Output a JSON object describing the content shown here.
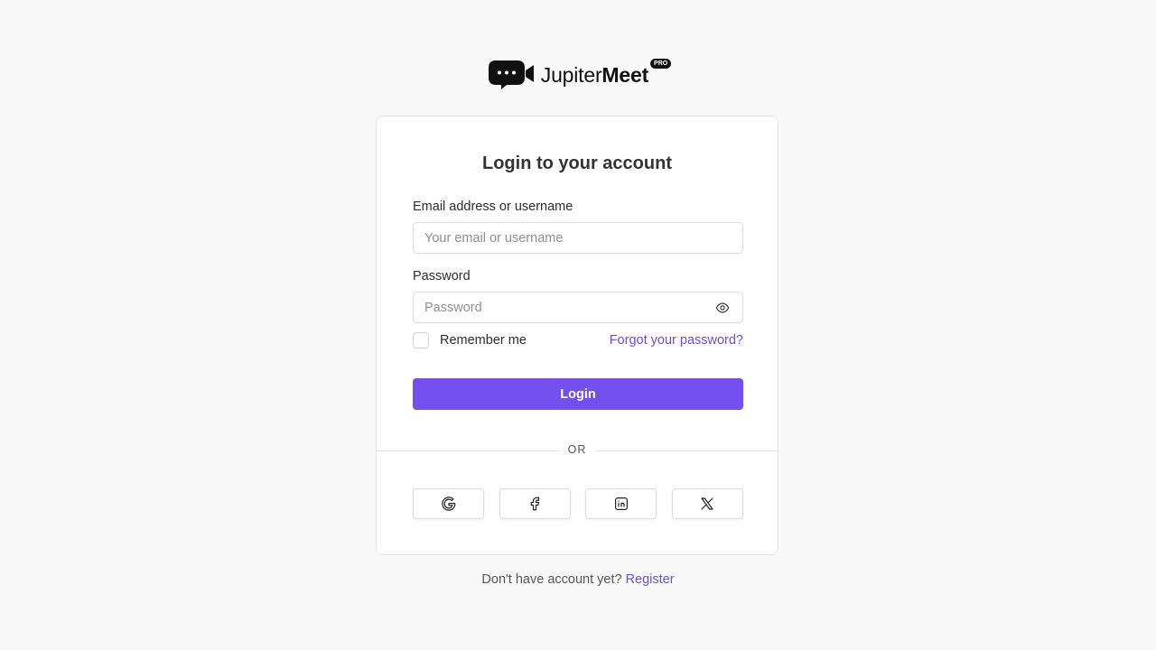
{
  "brand": {
    "name_light": "Jupiter",
    "name_bold": "Meet",
    "badge": "PRO",
    "logo_icon": "video-chat-icon"
  },
  "login": {
    "title": "Login to your account",
    "email_label": "Email address or username",
    "email_placeholder": "Your email or username",
    "email_value": "",
    "password_label": "Password",
    "password_placeholder": "Password",
    "password_value": "",
    "password_toggle_icon": "eye-icon",
    "remember_label": "Remember me",
    "remember_checked": false,
    "forgot_link": "Forgot your password?",
    "submit_label": "Login",
    "divider_text": "OR",
    "social": [
      {
        "name": "google",
        "icon": "google-icon"
      },
      {
        "name": "facebook",
        "icon": "facebook-icon"
      },
      {
        "name": "linkedin",
        "icon": "linkedin-icon"
      },
      {
        "name": "x",
        "icon": "x-icon"
      }
    ]
  },
  "footer": {
    "prompt": "Don't have account yet?",
    "register_link": "Register"
  },
  "colors": {
    "accent": "#7350ee",
    "link": "#6a4fe0",
    "background": "#f9f9f9",
    "card": "#ffffff"
  }
}
